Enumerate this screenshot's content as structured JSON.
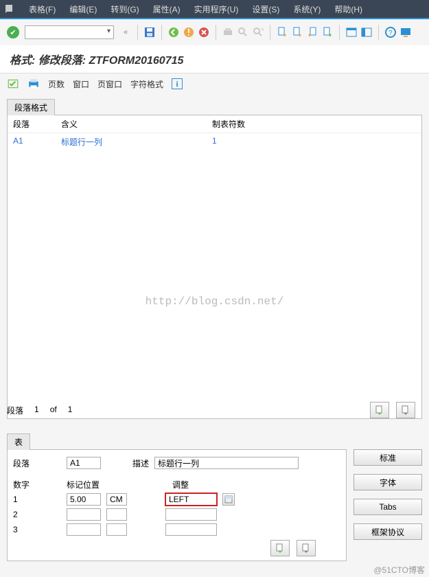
{
  "menu": {
    "items": [
      {
        "label": "表格(F)"
      },
      {
        "label": "编辑(E)"
      },
      {
        "label": "转到(G)"
      },
      {
        "label": "属性(A)"
      },
      {
        "label": "实用程序(U)"
      },
      {
        "label": "设置(S)"
      },
      {
        "label": "系统(Y)"
      },
      {
        "label": "帮助(H)"
      }
    ]
  },
  "title": "格式: 修改段落: ZTFORM20160715",
  "subtoolbar": {
    "links": [
      "页数",
      "窗口",
      "页窗口",
      "字符格式"
    ]
  },
  "panel1": {
    "tab": "段落格式",
    "headers": {
      "para": "段落",
      "meaning": "含义",
      "tabs": "制表符数"
    },
    "row": {
      "para": "A1",
      "meaning": "标题行一列",
      "tabs": "1"
    }
  },
  "pager": {
    "label": "段落",
    "cur": "1",
    "of": "of",
    "total": "1"
  },
  "panel2": {
    "tab": "表",
    "row1": {
      "para_lbl": "段落",
      "para_val": "A1",
      "desc_lbl": "描述",
      "desc_val": "标题行一列"
    },
    "hdr": {
      "num": "数字",
      "mark": "标记位置",
      "adj": "调整"
    },
    "rows": [
      {
        "num": "1",
        "mark": "5.00",
        "unit": "CM",
        "adj": "LEFT"
      },
      {
        "num": "2",
        "mark": "",
        "unit": "",
        "adj": ""
      },
      {
        "num": "3",
        "mark": "",
        "unit": "",
        "adj": ""
      }
    ]
  },
  "buttons": {
    "std": "标准",
    "font": "字体",
    "tabs": "Tabs",
    "frame": "框架协议"
  },
  "watermark": "http://blog.csdn.net/",
  "watermark2": "@51CTO博客"
}
